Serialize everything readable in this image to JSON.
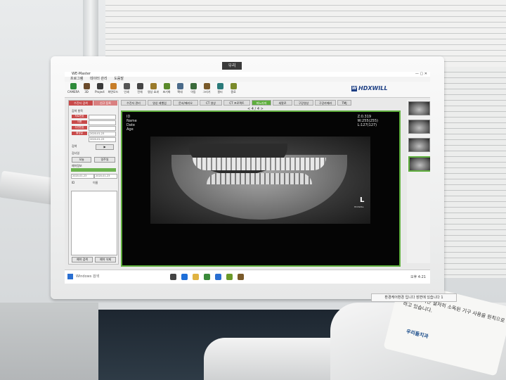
{
  "monitor": {
    "logo": "우리",
    "notice": "환경케어환경 입니다 장면에 있습니다 1"
  },
  "app": {
    "title": "WE-Master",
    "menu": [
      "프로그램",
      "데이터 관리",
      "도움말"
    ],
    "toolbar": [
      {
        "label": "CAMERA",
        "icon": "camera-icon",
        "color": "#2e8b3a"
      },
      {
        "label": "3D",
        "icon": "3d-icon",
        "color": "#6b4a2a"
      },
      {
        "label": "Project",
        "icon": "monitor-icon",
        "color": "#3a3a3a"
      },
      {
        "label": "화면모드",
        "icon": "layout-icon",
        "color": "#c77d28"
      },
      {
        "label": "인쇄",
        "icon": "print-icon",
        "color": "#555555"
      },
      {
        "label": "전체",
        "icon": "fullscreen-icon",
        "color": "#444444"
      },
      {
        "label": "영상 효과",
        "icon": "effect-icon",
        "color": "#9a7a2a"
      },
      {
        "label": "초기화",
        "icon": "reset-icon",
        "color": "#5a8a2a"
      },
      {
        "label": "확대",
        "icon": "zoom-icon",
        "color": "#4a6a8a"
      },
      {
        "label": "이동",
        "icon": "move-icon",
        "color": "#3a6a3a"
      },
      {
        "label": "그리기",
        "icon": "draw-icon",
        "color": "#7a5a2a"
      },
      {
        "label": "필터",
        "icon": "filter-icon",
        "color": "#2a7a7a"
      },
      {
        "label": "종료",
        "icon": "exit-icon",
        "color": "#7a8a2a"
      }
    ],
    "brand": "HDXWILL",
    "left_panel": {
      "tabs": [
        "수진자 검색",
        "신규 등록"
      ],
      "labels": [
        "검색 항목",
        "검사일",
        "검색",
        "환자",
        "예약정보"
      ],
      "fields": [
        "차트번호",
        "이름",
        "주민번호",
        "촬영일"
      ],
      "dates": [
        "2020-01-23",
        "2020-01-23"
      ],
      "buttons": [
        "오늘",
        "일주일",
        "예약 검색",
        "예약 삭제"
      ],
      "list_headers": [
        "ID",
        "이름"
      ]
    },
    "center_tabs": [
      "수진자 관리",
      "영상 레벨업",
      "문서/패리오",
      "CT 영상",
      "CT 프로젝트",
      "파노라마",
      "세팔로",
      "구강영상",
      "구강카메라",
      "TMJ"
    ],
    "active_tab": 5,
    "pager": "< 4 / 4 >",
    "viewer": {
      "meta_left": [
        "ID",
        "Name",
        "Date",
        "Age"
      ],
      "meta_right": [
        "Z:0.319",
        "W:255(255)",
        "L:127(127)"
      ],
      "mark": "L",
      "mark_sub": "HDXWILL"
    },
    "taskbar": {
      "search": "Windows 검색",
      "tray": "오후 4:21"
    }
  },
  "sticker": {
    "text": "우리들치과는 철저히 소독된 기구 사용을 원칙으로 하고 있습니다.",
    "logo": "우리들치과"
  }
}
